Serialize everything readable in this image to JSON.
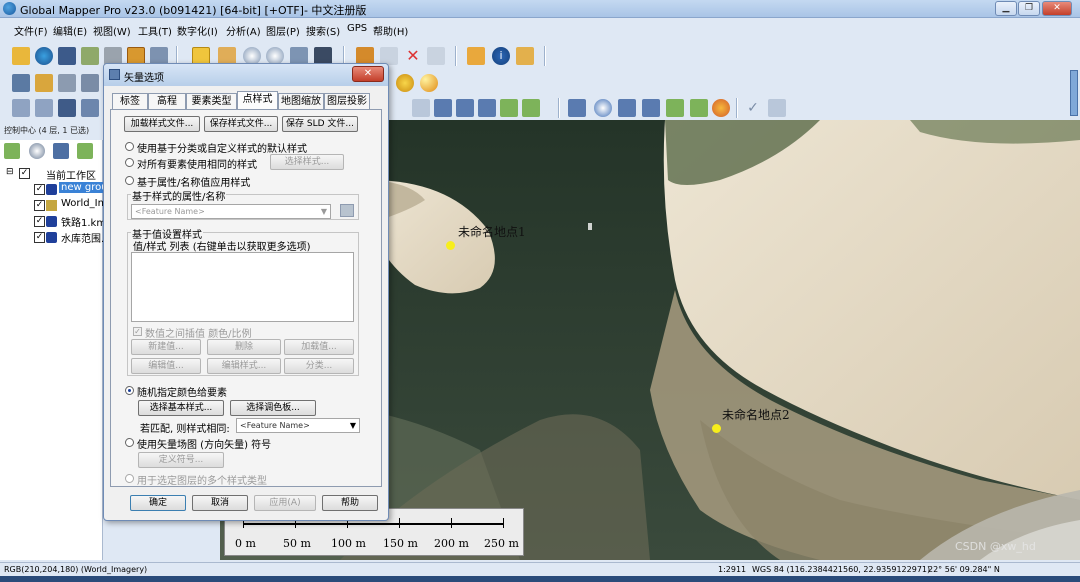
{
  "window": {
    "title": "Global Mapper Pro v23.0 (b091421) [64-bit] [+OTF]- 中文注册版"
  },
  "menu": [
    "文件(F)",
    "编辑(E)",
    "视图(W)",
    "工具(T)",
    "数字化(I)",
    "分析(A)",
    "图层(P)",
    "搜索(S)",
    "GPS",
    "帮助(H)"
  ],
  "panel": {
    "header": "控制中心 (4 层, 1 已选)",
    "workspace": "当前工作区",
    "layers": [
      "new grou",
      "World_Im",
      "铁路1.km",
      "水库范围."
    ]
  },
  "dialog": {
    "title": "矢量选项",
    "close_label": "✕",
    "tabs": [
      "标签",
      "高程",
      "要素类型",
      "点样式",
      "地图缩放",
      "图层投影"
    ],
    "active_tab": "点样式",
    "load_style_btn": "加载样式文件...",
    "save_style_btn": "保存样式文件...",
    "save_sld_btn": "保存 SLD 文件...",
    "opt_default": "使用基于分类或自定义样式的默认样式",
    "opt_same": "对所有要素使用相同的样式",
    "select_style_btn": "选择样式...",
    "opt_attr": "基于属性/名称值应用样式",
    "attr_group_label": "基于样式的属性/名称",
    "attr_combo": "<Feature Name>",
    "value_group_label": "基于值设置样式",
    "value_list_label": "值/样式 列表 (右键单击以获取更多选项)",
    "interp_label": "数值之间插值 颜色/比例",
    "new_value_btn": "新建值...",
    "delete_btn": "删除",
    "load_value_btn": "加载值...",
    "edit_value_btn": "编辑值...",
    "edit_style_btn": "编辑样式...",
    "classify_btn": "分类...",
    "opt_random": "随机指定颜色给要素",
    "select_base_style_btn": "选择基本样式...",
    "select_palette_btn": "选择调色板...",
    "match_label": "若匹配, 则样式相同:",
    "match_combo": "<Feature Name>",
    "opt_vector_field": "使用矢量场图 (方向矢量) 符号",
    "define_symbol_btn": "定义符号...",
    "opt_multi": "用于选定图层的多个样式类型",
    "ok_btn": "确定",
    "cancel_btn": "取消",
    "apply_btn": "应用(A)",
    "help_btn": "帮助"
  },
  "map": {
    "points": [
      {
        "label": "未命名地点1"
      },
      {
        "label": "未命名地点2"
      }
    ],
    "scale_labels": [
      "0 m",
      "50 m",
      "100 m",
      "150 m",
      "200 m",
      "250 m"
    ],
    "watermark": "CSDN @xw_hd",
    "point_color": "#f7ee1b"
  },
  "status": {
    "left": "RGB(210,204,180) (World_Imagery)",
    "scale": "1:2911",
    "coords": "WGS 84 (116.2384421560, 22.9359122971)",
    "dms": "22° 56' 09.284\" N"
  }
}
